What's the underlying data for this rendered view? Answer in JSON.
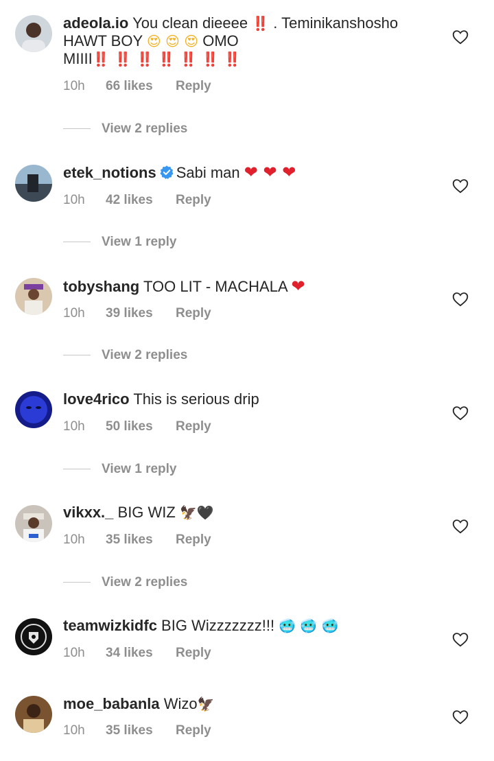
{
  "comments": [
    {
      "username": "adeola.io",
      "text_a": " You clean dieeee",
      "emoji_a": "‼️",
      "text_b": ". Teminikanshosho",
      "line2": "HAWT BOY ",
      "emoji_b": "😍 😍 😍",
      "text_c": " OMO",
      "line3": "MIIII",
      "emoji_c": "‼️ ‼️ ‼️ ‼️ ‼️ ‼️ ‼️",
      "time": "10h",
      "likes": "66 likes",
      "reply": "Reply",
      "view_replies": "View 2 replies"
    },
    {
      "username": "etek_notions",
      "text": "Sabi man ",
      "emoji": "❤ ❤ ❤",
      "time": "10h",
      "likes": "42 likes",
      "reply": "Reply",
      "view_replies": "View 1 reply"
    },
    {
      "username": "tobyshang",
      "text": " TOO LIT - MACHALA ",
      "emoji": "❤",
      "time": "10h",
      "likes": "39 likes",
      "reply": "Reply",
      "view_replies": "View 2 replies"
    },
    {
      "username": "love4rico",
      "text": " This is serious drip",
      "time": "10h",
      "likes": "50 likes",
      "reply": "Reply",
      "view_replies": "View 1 reply"
    },
    {
      "username": "vikxx._",
      "text": " BIG WIZ ",
      "emoji": "🦅🖤",
      "time": "10h",
      "likes": "35 likes",
      "reply": "Reply",
      "view_replies": "View 2 replies"
    },
    {
      "username": "teamwizkidfc",
      "text": " BIG Wizzzzzzz!!! ",
      "emoji": "🥶 🥶 🥶",
      "time": "10h",
      "likes": "34 likes",
      "reply": "Reply"
    },
    {
      "username": "moe_babanla",
      "text": " Wizo",
      "emoji": "🦅",
      "time": "10h",
      "likes": "35 likes",
      "reply": "Reply"
    }
  ],
  "colors": {
    "text": "#262626",
    "meta": "#8e8e8e",
    "verified": "#3897f0",
    "heart_emoji": "#e0202c"
  }
}
